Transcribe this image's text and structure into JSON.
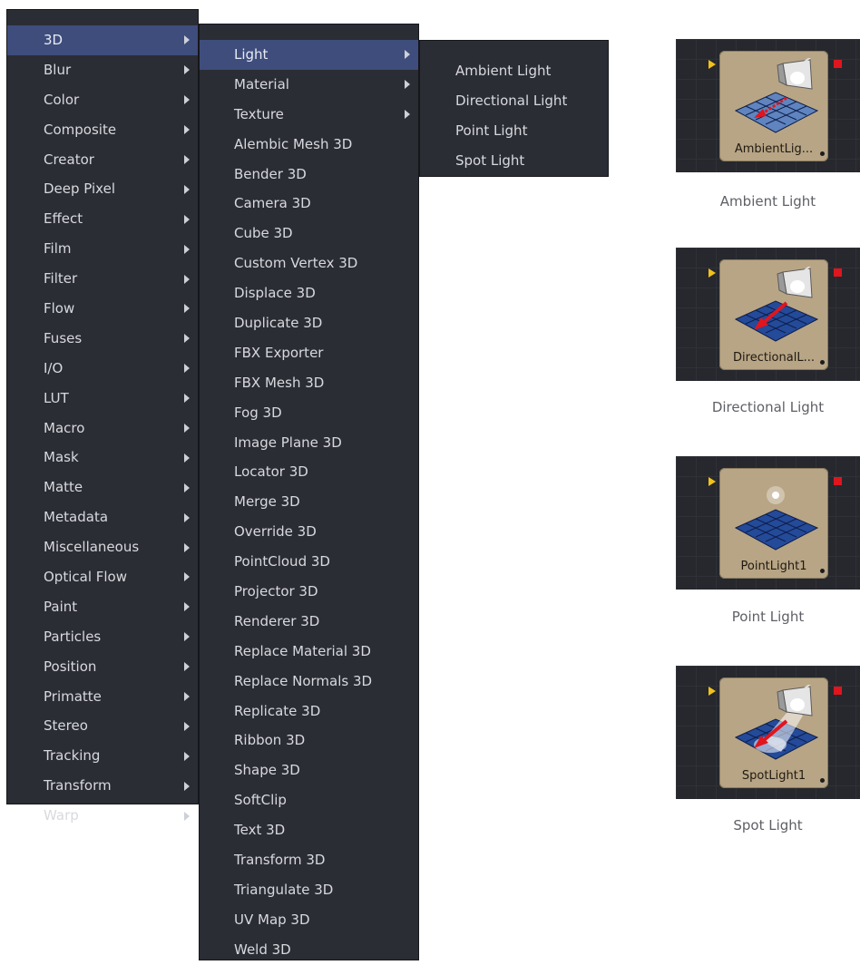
{
  "menu_level1": {
    "items": [
      {
        "label": "3D",
        "has_submenu": true,
        "active": true
      },
      {
        "label": "Blur",
        "has_submenu": true
      },
      {
        "label": "Color",
        "has_submenu": true
      },
      {
        "label": "Composite",
        "has_submenu": true
      },
      {
        "label": "Creator",
        "has_submenu": true
      },
      {
        "label": "Deep Pixel",
        "has_submenu": true
      },
      {
        "label": "Effect",
        "has_submenu": true
      },
      {
        "label": "Film",
        "has_submenu": true
      },
      {
        "label": "Filter",
        "has_submenu": true
      },
      {
        "label": "Flow",
        "has_submenu": true
      },
      {
        "label": "Fuses",
        "has_submenu": true
      },
      {
        "label": "I/O",
        "has_submenu": true
      },
      {
        "label": "LUT",
        "has_submenu": true
      },
      {
        "label": "Macro",
        "has_submenu": true
      },
      {
        "label": "Mask",
        "has_submenu": true
      },
      {
        "label": "Matte",
        "has_submenu": true
      },
      {
        "label": "Metadata",
        "has_submenu": true
      },
      {
        "label": "Miscellaneous",
        "has_submenu": true
      },
      {
        "label": "Optical Flow",
        "has_submenu": true
      },
      {
        "label": "Paint",
        "has_submenu": true
      },
      {
        "label": "Particles",
        "has_submenu": true
      },
      {
        "label": "Position",
        "has_submenu": true
      },
      {
        "label": "Primatte",
        "has_submenu": true
      },
      {
        "label": "Stereo",
        "has_submenu": true
      },
      {
        "label": "Tracking",
        "has_submenu": true
      },
      {
        "label": "Transform",
        "has_submenu": true
      },
      {
        "label": "Warp",
        "has_submenu": true
      }
    ]
  },
  "menu_level2": {
    "items": [
      {
        "label": "Light",
        "has_submenu": true,
        "active": true
      },
      {
        "label": "Material",
        "has_submenu": true
      },
      {
        "label": "Texture",
        "has_submenu": true
      },
      {
        "label": "Alembic Mesh 3D"
      },
      {
        "label": "Bender 3D"
      },
      {
        "label": "Camera 3D"
      },
      {
        "label": "Cube 3D"
      },
      {
        "label": "Custom Vertex 3D"
      },
      {
        "label": "Displace 3D"
      },
      {
        "label": "Duplicate 3D"
      },
      {
        "label": "FBX Exporter"
      },
      {
        "label": "FBX Mesh 3D"
      },
      {
        "label": "Fog 3D"
      },
      {
        "label": "Image Plane 3D"
      },
      {
        "label": "Locator 3D"
      },
      {
        "label": "Merge 3D"
      },
      {
        "label": "Override 3D"
      },
      {
        "label": "PointCloud 3D"
      },
      {
        "label": "Projector 3D"
      },
      {
        "label": "Renderer 3D"
      },
      {
        "label": "Replace Material 3D"
      },
      {
        "label": "Replace Normals 3D"
      },
      {
        "label": "Replicate 3D"
      },
      {
        "label": "Ribbon 3D"
      },
      {
        "label": "Shape 3D"
      },
      {
        "label": "SoftClip"
      },
      {
        "label": "Text 3D"
      },
      {
        "label": "Transform 3D"
      },
      {
        "label": "Triangulate 3D"
      },
      {
        "label": "UV Map 3D"
      },
      {
        "label": "Weld 3D"
      }
    ]
  },
  "menu_level3": {
    "items": [
      {
        "label": "Ambient Light"
      },
      {
        "label": "Directional Light"
      },
      {
        "label": "Point Light"
      },
      {
        "label": "Spot Light"
      }
    ]
  },
  "nodes": [
    {
      "tile_label": "AmbientLig...",
      "caption": "Ambient Light",
      "icon": "ambient-light-icon"
    },
    {
      "tile_label": "DirectionalL...",
      "caption": "Directional Light",
      "icon": "directional-light-icon"
    },
    {
      "tile_label": "PointLight1",
      "caption": "Point Light",
      "icon": "point-light-icon"
    },
    {
      "tile_label": "SpotLight1",
      "caption": "Spot Light",
      "icon": "spot-light-icon"
    }
  ],
  "colors": {
    "menu_bg": "#2b2d35",
    "menu_highlight": "#3e4d7c",
    "menu_text": "#d8d9de",
    "node_tile": "#b8a585",
    "input_arrow": "#f2c21b",
    "output_square": "#e0151e"
  }
}
